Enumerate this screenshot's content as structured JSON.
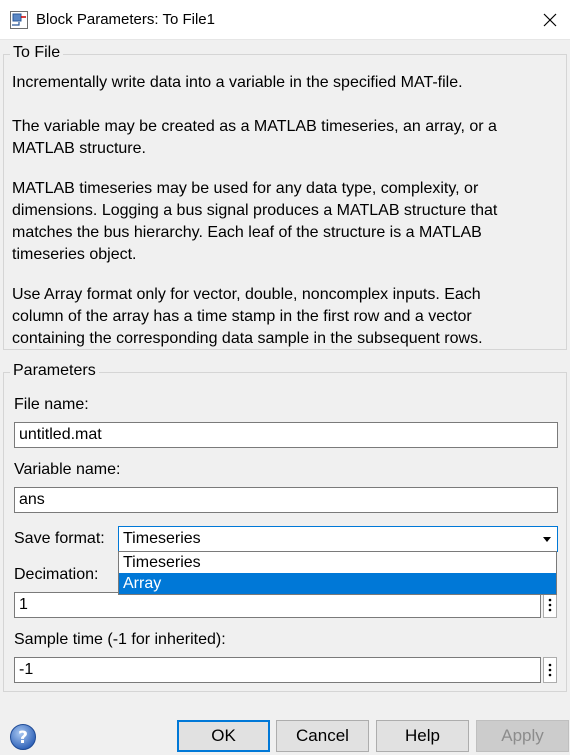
{
  "window": {
    "title": "Block Parameters: To File1"
  },
  "description": {
    "group_title": "To File",
    "p1": "Incrementally write data into a variable in the specified MAT-file.",
    "p2_lines": [
      "The variable may be created as a MATLAB timeseries, an array, or a",
      "MATLAB structure."
    ],
    "p3_lines": [
      "MATLAB timeseries may be used for any data type, complexity, or",
      "dimensions. Logging a bus signal produces a MATLAB structure that",
      "matches the bus hierarchy. Each leaf of the structure is a MATLAB",
      "timeseries object."
    ],
    "p4_lines": [
      "Use Array format only for vector, double, noncomplex inputs. Each",
      "column of the array has a time stamp in the first row and a vector",
      "containing the corresponding data sample in the subsequent rows."
    ]
  },
  "parameters": {
    "group_title": "Parameters",
    "file_name_label": "File name:",
    "file_name_value": "untitled.mat",
    "variable_name_label": "Variable name:",
    "variable_name_value": "ans",
    "save_format_label": "Save format:",
    "save_format_value": "Timeseries",
    "save_format_options": [
      "Timeseries",
      "Array"
    ],
    "save_format_highlighted": "Array",
    "decimation_label": "Decimation:",
    "decimation_value": "1",
    "sample_time_label": "Sample time (-1 for inherited):",
    "sample_time_value": "-1"
  },
  "buttons": {
    "ok": "OK",
    "cancel": "Cancel",
    "help": "Help",
    "apply": "Apply"
  },
  "colors": {
    "accent": "#0078d7",
    "background": "#f0f0f0"
  },
  "icons": {
    "app": "simulink-block-icon",
    "close": "close-icon",
    "help": "question-mark-icon",
    "more": "vertical-ellipsis-icon"
  }
}
